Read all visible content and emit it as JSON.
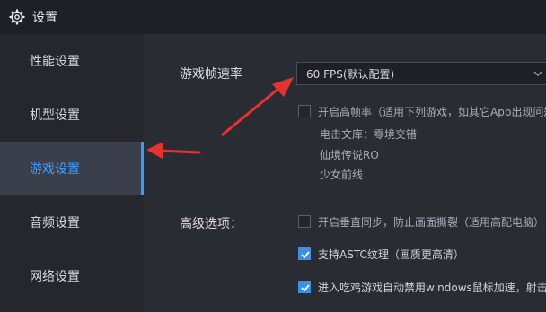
{
  "window": {
    "title": "设置",
    "icon": "gear-icon"
  },
  "sidebar": {
    "items": [
      {
        "label": "性能设置"
      },
      {
        "label": "机型设置"
      },
      {
        "label": "游戏设置"
      },
      {
        "label": "音频设置"
      },
      {
        "label": "网络设置"
      }
    ],
    "active_index": 2
  },
  "game": {
    "fps_label": "游戏帧速率",
    "fps_value": "60 FPS(默认配置)",
    "high_fps": {
      "label": "开启高帧率（适用下列游戏，如其它App出现问题",
      "checked": false,
      "games": [
        "电击文库：零境交错",
        "仙境传说RO",
        "少女前线"
      ]
    },
    "advanced_label": "高级选项：",
    "options": [
      {
        "label": "开启垂直同步，防止画面撕裂（适用高配电脑）",
        "checked": false
      },
      {
        "label": "支持ASTC纹理（画质更高清）",
        "checked": true
      },
      {
        "label": "进入吃鸡游戏自动禁用windows鼠标加速，射击",
        "checked": true
      }
    ]
  },
  "colors": {
    "accent": "#3d9bff",
    "annotation_arrow": "#e8322d",
    "checkbox_checked": "#3d8fe8"
  }
}
